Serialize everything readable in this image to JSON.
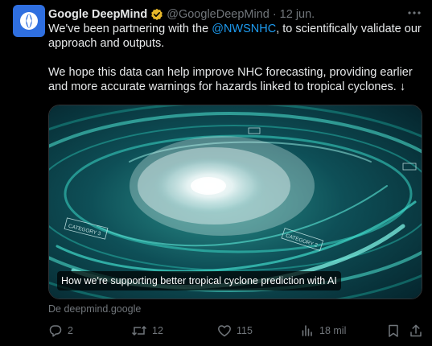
{
  "author": {
    "display_name": "Google DeepMind",
    "handle": "@GoogleDeepMind",
    "separator": "·",
    "timestamp": "12 jun."
  },
  "tweet": {
    "line1_prefix": "We've been partnering with the ",
    "mention": "@NWSNHC",
    "line1_suffix": ", to scientifically validate our approach and outputs.",
    "paragraph2": "We hope this data can help improve NHC forecasting, providing earlier and more accurate warnings for hazards linked to tropical cyclones. ↓"
  },
  "card": {
    "caption": "How we're supporting better tropical cyclone prediction with AI",
    "source": "De deepmind.google",
    "overlay_labels": [
      "CATEGORY 3",
      "CATEGORY 2"
    ]
  },
  "actions": {
    "replies": "2",
    "reposts": "12",
    "likes": "115",
    "views": "18 mil"
  },
  "icons": {
    "avatar": "deepmind-logo-icon",
    "verified": "gold-verified-badge-icon",
    "more": "more-dots-icon",
    "reply": "reply-icon",
    "repost": "repost-icon",
    "like": "heart-icon",
    "views": "views-chart-icon",
    "bookmark": "bookmark-icon",
    "share": "share-icon"
  },
  "colors": {
    "background": "#000000",
    "text": "#e7e9ea",
    "muted": "#71767b",
    "link": "#1d9bf0",
    "verified_gold": "#e8b829"
  }
}
